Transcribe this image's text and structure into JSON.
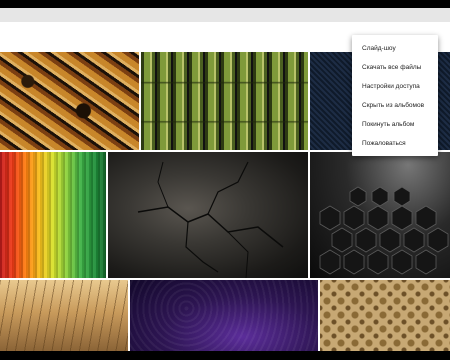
{
  "menu": {
    "items": [
      {
        "label": "Слайд-шоу"
      },
      {
        "label": "Скачать все файлы"
      },
      {
        "label": "Настройки доступа"
      },
      {
        "label": "Скрыть из альбомов"
      },
      {
        "label": "Покинуть альбом"
      },
      {
        "label": "Пожаловаться"
      }
    ]
  },
  "gallery": {
    "photos": [
      {
        "name": "feathers"
      },
      {
        "name": "bamboo"
      },
      {
        "name": "blue-texture"
      },
      {
        "name": "rainbow-stripes"
      },
      {
        "name": "cracked-stone"
      },
      {
        "name": "dark-hexagons"
      },
      {
        "name": "wood-floor"
      },
      {
        "name": "purple-pattern"
      },
      {
        "name": "gold-damask"
      }
    ]
  },
  "colors": {
    "toolbar": "#e6e6e6",
    "background": "#ffffff",
    "menu_text": "#222222"
  }
}
